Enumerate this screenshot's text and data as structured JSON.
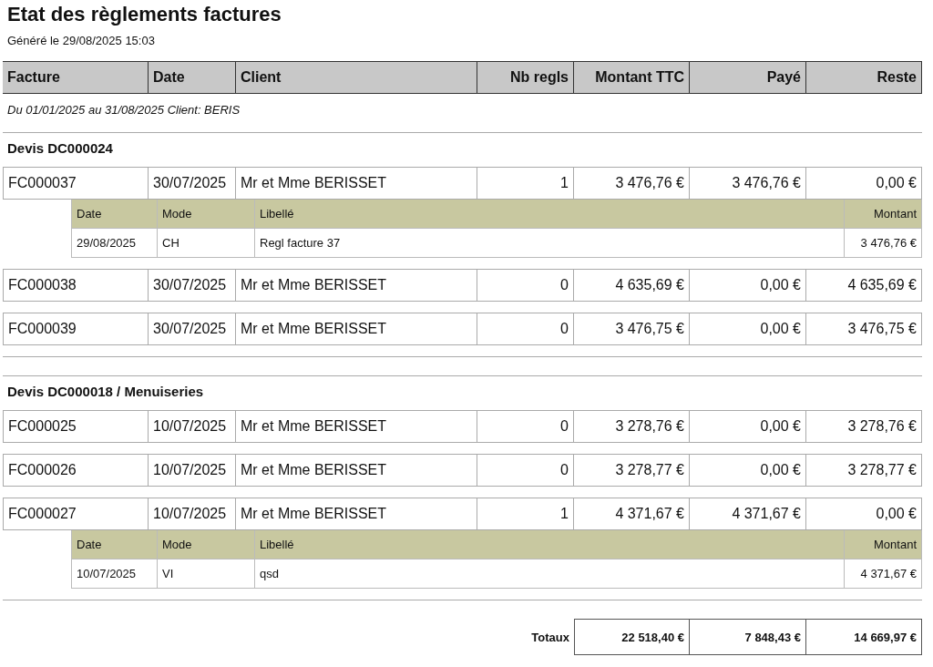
{
  "title": "Etat des règlements factures",
  "generated": "Généré le 29/08/2025 15:03",
  "columns": [
    "Facture",
    "Date",
    "Client",
    "Nb regls",
    "Montant TTC",
    "Payé",
    "Reste"
  ],
  "filter": "Du 01/01/2025 au 31/08/2025 Client: BERIS",
  "groups": [
    {
      "title": "Devis DC000024",
      "invoices": [
        {
          "invoice": "FC000037",
          "date": "30/07/2025",
          "client": "Mr et Mme BERISSET",
          "count": "1",
          "amount": "3 476,76 €",
          "paid": "3 476,76 €",
          "remaining": "0,00 €",
          "payments": {
            "columns": [
              "Date",
              "Mode",
              "Libellé",
              "Montant"
            ],
            "rows": [
              {
                "date": "29/08/2025",
                "mode": "CH",
                "label": "Regl facture 37",
                "amount": "3 476,76 €"
              }
            ]
          }
        },
        {
          "invoice": "FC000038",
          "date": "30/07/2025",
          "client": "Mr et Mme BERISSET",
          "count": "0",
          "amount": "4 635,69 €",
          "paid": "0,00 €",
          "remaining": "4 635,69 €"
        },
        {
          "invoice": "FC000039",
          "date": "30/07/2025",
          "client": "Mr et Mme BERISSET",
          "count": "0",
          "amount": "3 476,75 €",
          "paid": "0,00 €",
          "remaining": "3 476,75 €"
        }
      ]
    },
    {
      "title": "Devis DC000018 / Menuiseries",
      "invoices": [
        {
          "invoice": "FC000025",
          "date": "10/07/2025",
          "client": "Mr et Mme BERISSET",
          "count": "0",
          "amount": "3 278,76 €",
          "paid": "0,00 €",
          "remaining": "3 278,76 €"
        },
        {
          "invoice": "FC000026",
          "date": "10/07/2025",
          "client": "Mr et Mme BERISSET",
          "count": "0",
          "amount": "3 278,77 €",
          "paid": "0,00 €",
          "remaining": "3 278,77 €"
        },
        {
          "invoice": "FC000027",
          "date": "10/07/2025",
          "client": "Mr et Mme BERISSET",
          "count": "1",
          "amount": "4 371,67 €",
          "paid": "4 371,67 €",
          "remaining": "0,00 €",
          "payments": {
            "columns": [
              "Date",
              "Mode",
              "Libellé",
              "Montant"
            ],
            "rows": [
              {
                "date": "10/07/2025",
                "mode": "VI",
                "label": "qsd",
                "amount": "4 371,67 €"
              }
            ]
          }
        }
      ]
    }
  ],
  "totals": {
    "label": "Totaux",
    "amount": "22 518,40 €",
    "paid": "7 848,43 €",
    "remaining": "14 669,97 €"
  }
}
